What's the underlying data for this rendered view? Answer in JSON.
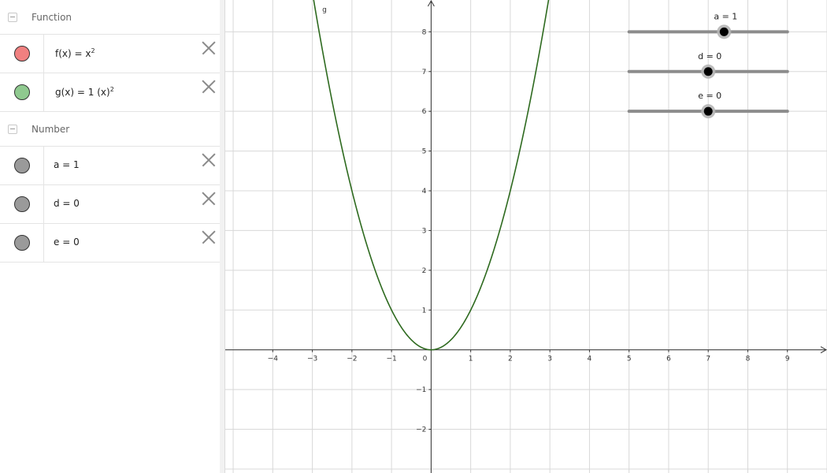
{
  "algebra": {
    "groups": [
      {
        "title": "Function",
        "items": [
          {
            "name": "f",
            "lhs": "f(x) = x",
            "exp": "2",
            "color": "#f08080"
          },
          {
            "name": "g",
            "lhs": "g(x) = 1 (x)",
            "exp": "2",
            "color": "#8fc98f"
          }
        ]
      },
      {
        "title": "Number",
        "items": [
          {
            "name": "a",
            "text": "a = 1",
            "color": "#9a9a9a"
          },
          {
            "name": "d",
            "text": "d = 0",
            "color": "#9a9a9a"
          },
          {
            "name": "e",
            "text": "e = 0",
            "color": "#9a9a9a"
          }
        ]
      }
    ]
  },
  "graphics": {
    "x_range": [
      -5.2,
      10.0
    ],
    "y_range": [
      -3.1,
      8.8
    ],
    "x_ticks": [
      -4,
      -3,
      -2,
      -1,
      1,
      2,
      3,
      4,
      5,
      6,
      7,
      8,
      9
    ],
    "y_ticks": [
      -2,
      -1,
      1,
      2,
      3,
      4,
      5,
      6,
      7,
      8
    ],
    "origin_label": "0",
    "curve_label": "g",
    "curve_color": "#2e6a1f",
    "sliders": [
      {
        "label": "a = 1",
        "min": 5,
        "max": 9,
        "row_y": 8,
        "value": 7.4
      },
      {
        "label": "d = 0",
        "min": 5,
        "max": 9,
        "row_y": 7,
        "value": 7
      },
      {
        "label": "e = 0",
        "min": 5,
        "max": 9,
        "row_y": 6,
        "value": 7
      }
    ]
  }
}
